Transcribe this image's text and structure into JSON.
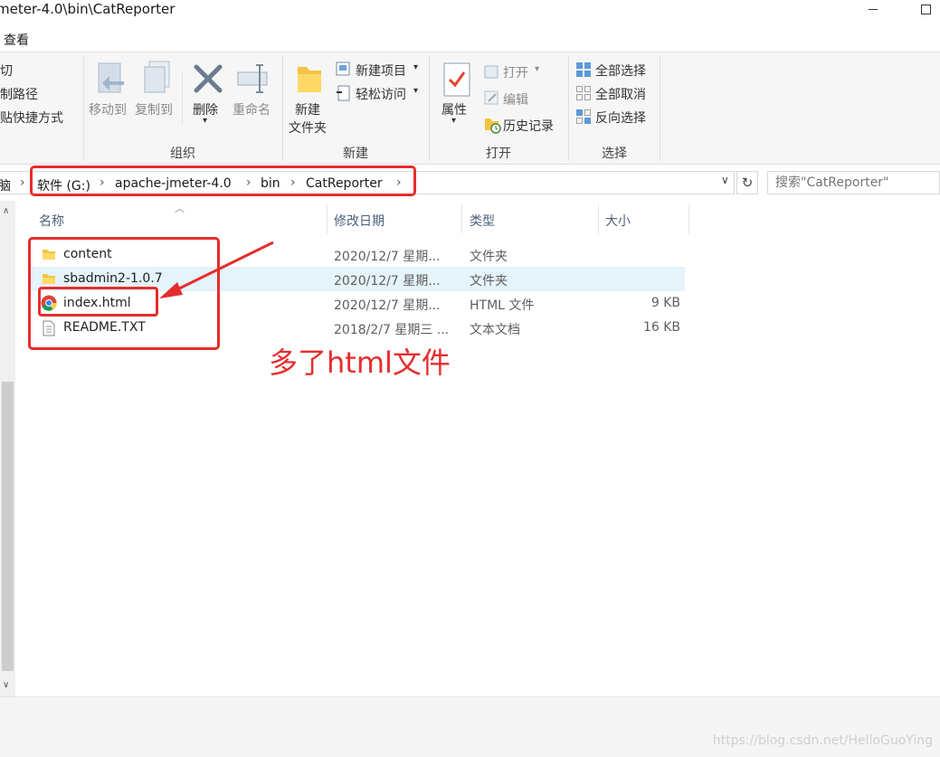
{
  "window": {
    "title": "meter-4.0\\bin\\CatReporter"
  },
  "menu": {
    "view": "查看"
  },
  "ribbon": {
    "clipboard": {
      "cut": "剪切",
      "copy_path": "复制路径",
      "paste_shortcut": "粘贴快捷方式"
    },
    "organize": {
      "move_to": "移动到",
      "copy_to": "复制到",
      "delete": "删除",
      "rename": "重命名",
      "group_label": "组织"
    },
    "new": {
      "new_folder_line1": "新建",
      "new_folder_line2": "文件夹",
      "new_item": "新建项目",
      "easy_access": "轻松访问",
      "group_label": "新建"
    },
    "open": {
      "properties": "属性",
      "open": "打开",
      "edit": "编辑",
      "history": "历史记录",
      "group_label": "打开"
    },
    "select": {
      "select_all": "全部选择",
      "select_none": "全部取消",
      "invert": "反向选择",
      "group_label": "选择"
    }
  },
  "address": {
    "partial": "脑",
    "crumbs": [
      "软件 (G:)",
      "apache-jmeter-4.0",
      "bin",
      "CatReporter"
    ],
    "search_placeholder": "搜索\"CatReporter\""
  },
  "columns": {
    "name": "名称",
    "modified": "修改日期",
    "type": "类型",
    "size": "大小"
  },
  "files": [
    {
      "name": "content",
      "modified": "2020/12/7 星期...",
      "type": "文件夹",
      "size": "",
      "icon": "folder-icon"
    },
    {
      "name": "sbadmin2-1.0.7",
      "modified": "2020/12/7 星期...",
      "type": "文件夹",
      "size": "",
      "icon": "folder-icon"
    },
    {
      "name": "index.html",
      "modified": "2020/12/7 星期...",
      "type": "HTML 文件",
      "size": "9 KB",
      "icon": "chrome-icon"
    },
    {
      "name": "README.TXT",
      "modified": "2018/2/7 星期三 ...",
      "type": "文本文档",
      "size": "16 KB",
      "icon": "text-file-icon"
    }
  ],
  "annotation": {
    "text": "多了html文件"
  },
  "watermark": "https://blog.csdn.net/HelloGuoYing",
  "colors": {
    "accent_red": "#e52d2d",
    "selection": "#e5f3fb",
    "header_text": "#4c607a"
  }
}
